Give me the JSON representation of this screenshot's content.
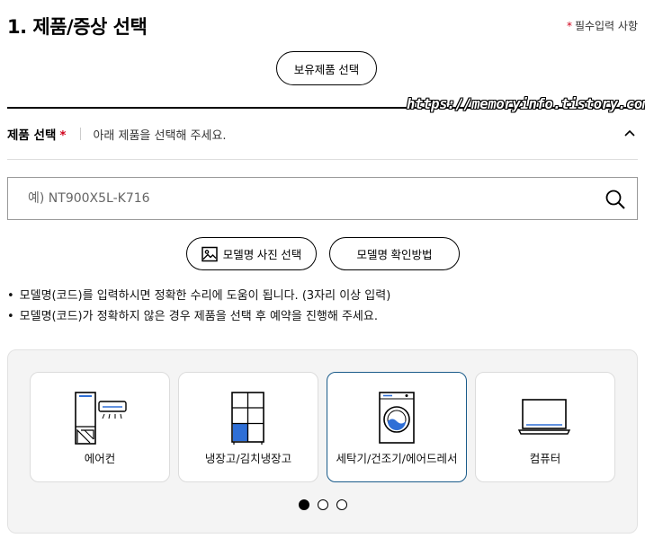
{
  "header": {
    "title": "1. 제품/증상 선택",
    "required_star": "*",
    "required_note": "필수입력 사항"
  },
  "owned_products_button": "보유제품 선택",
  "watermark": "https://memoryinfo.tistory.com",
  "product_select": {
    "label": "제품 선택",
    "required_star": "*",
    "help_text": "아래 제품을 선택해 주세요.",
    "collapse_icon": "chevron-up-icon"
  },
  "search": {
    "placeholder": "예) NT900X5L-K716",
    "value": "",
    "icon": "search-icon"
  },
  "model_buttons": {
    "photo_label": "모델명 사진 선택",
    "photo_icon": "image-icon",
    "howto_label": "모델명 확인방법"
  },
  "notes": [
    "모델명(코드)를 입력하시면 정확한 수리에 도움이 됩니다. (3자리 이상 입력)",
    "모델명(코드)가 정확하지 않은 경우 제품을 선택 후 예약을 진행해 주세요."
  ],
  "categories": [
    {
      "label": "에어컨",
      "icon": "air-conditioner-icon",
      "selected": false
    },
    {
      "label": "냉장고/김치냉장고",
      "icon": "refrigerator-icon",
      "selected": false
    },
    {
      "label": "세탁기/건조기/에어드레서",
      "icon": "washing-machine-icon",
      "selected": true
    },
    {
      "label": "컴퓨터",
      "icon": "laptop-icon",
      "selected": false
    }
  ],
  "pagination": {
    "total_pages": 3,
    "current_page": 1
  },
  "colors": {
    "required": "#d0021b",
    "accent_blue": "#2f6fd6",
    "selected_border": "#1a5b8a"
  }
}
